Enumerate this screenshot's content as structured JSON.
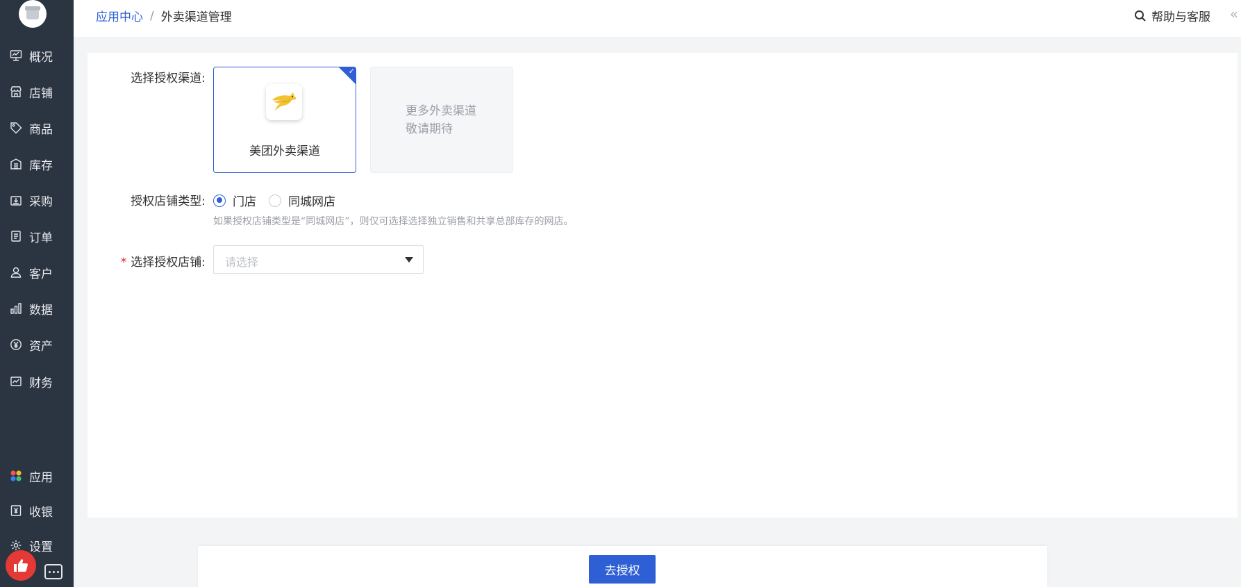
{
  "sidebar": {
    "items": [
      {
        "label": "概况",
        "icon": "overview-icon"
      },
      {
        "label": "店铺",
        "icon": "store-icon"
      },
      {
        "label": "商品",
        "icon": "tag-icon"
      },
      {
        "label": "库存",
        "icon": "warehouse-icon"
      },
      {
        "label": "采购",
        "icon": "purchase-icon"
      },
      {
        "label": "订单",
        "icon": "order-icon"
      },
      {
        "label": "客户",
        "icon": "customer-icon"
      },
      {
        "label": "数据",
        "icon": "data-icon"
      },
      {
        "label": "资产",
        "icon": "yen-icon"
      },
      {
        "label": "财务",
        "icon": "finance-icon"
      }
    ],
    "bottom_items": [
      {
        "label": "应用",
        "icon": "apps-icon"
      },
      {
        "label": "收银",
        "icon": "cashier-icon"
      },
      {
        "label": "设置",
        "icon": "settings-icon"
      }
    ]
  },
  "header": {
    "breadcrumb_root": "应用中心",
    "breadcrumb_sep": "/",
    "breadcrumb_current": "外卖渠道管理",
    "help_label": "帮助与客服",
    "collapse_glyph": "«"
  },
  "form": {
    "channel_label": "选择授权渠道:",
    "channels": {
      "selected_name": "美团外卖渠道",
      "more_line1": "更多外卖渠道",
      "more_line2": "敬请期待"
    },
    "store_type_label": "授权店铺类型:",
    "store_type_options": [
      "门店",
      "同城网店"
    ],
    "store_type_selected": "门店",
    "store_type_hint": "如果授权店铺类型是“同城网店”，则仅可选择选择独立销售和共享总部库存的网店。",
    "store_label": "选择授权店铺:",
    "store_required_mark": "*",
    "store_placeholder": "请选择"
  },
  "footer": {
    "submit_label": "去授权"
  },
  "colors": {
    "accent": "#2f5fd4",
    "sidebar_bg": "#2b3441",
    "required": "#e02020"
  }
}
